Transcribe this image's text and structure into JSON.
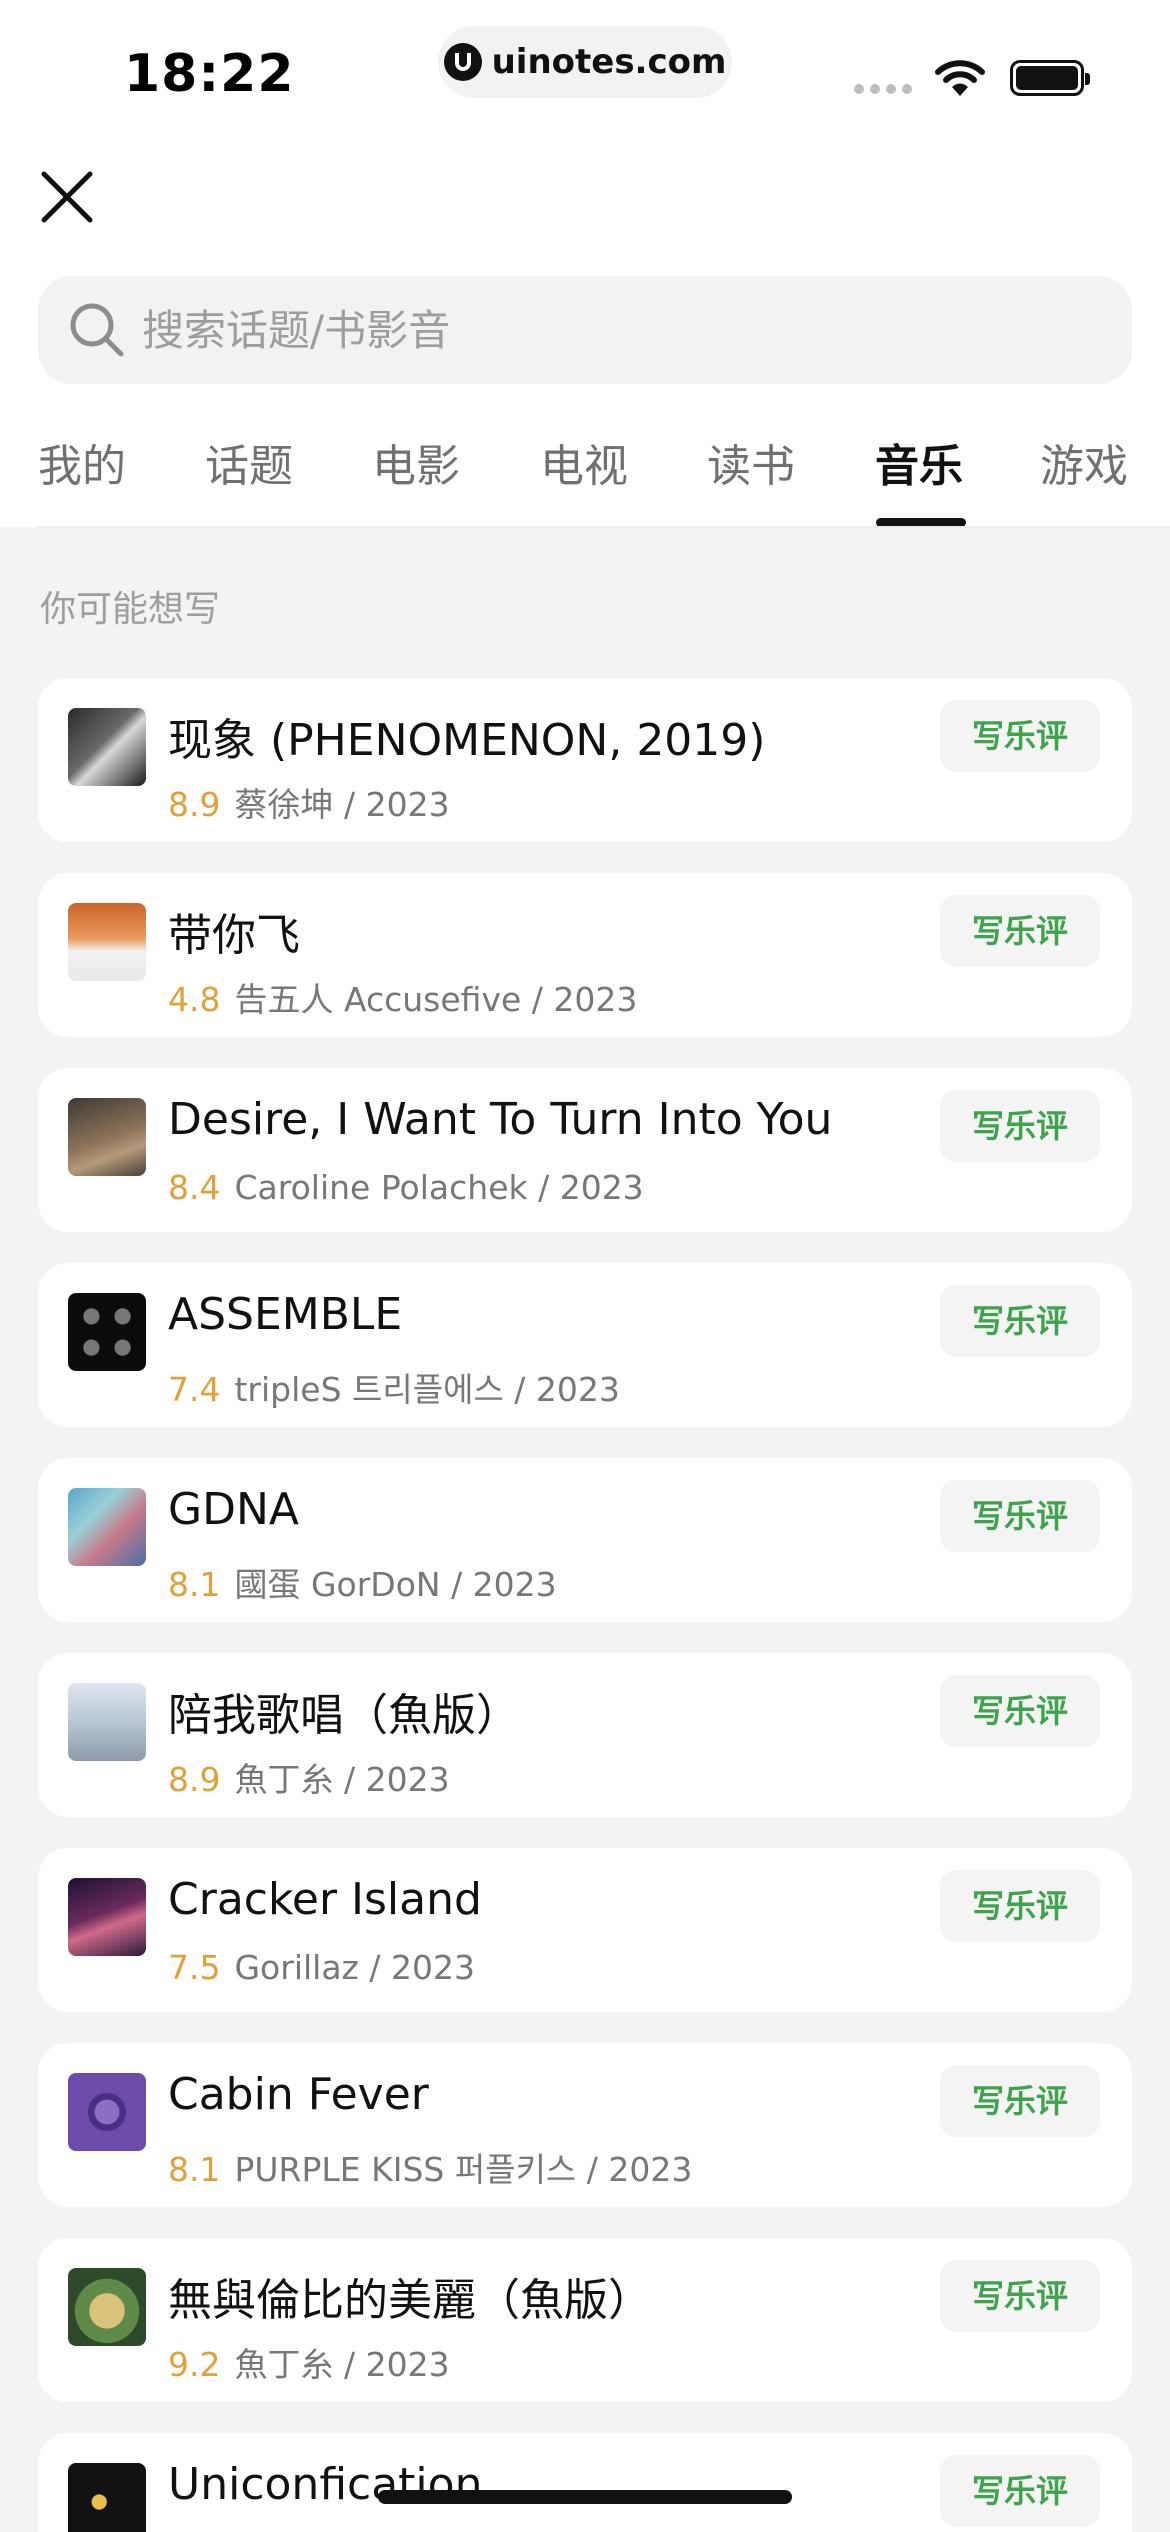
{
  "status": {
    "time": "18:22",
    "url": "uinotes.com"
  },
  "search": {
    "placeholder": "搜索话题/书影音"
  },
  "tabs": [
    "我的",
    "话题",
    "电影",
    "电视",
    "读书",
    "音乐",
    "游戏"
  ],
  "active_tab": "音乐",
  "section_title": "你可能想写",
  "review_label": "写乐评",
  "items": [
    {
      "title": "现象 (PHENOMENON, 2019)",
      "rating": "8.9",
      "subtitle": "蔡徐坤 / 2023"
    },
    {
      "title": "带你飞",
      "rating": "4.8",
      "subtitle": "告五人 Accusefive / 2023"
    },
    {
      "title": "Desire, I Want To Turn Into You",
      "rating": "8.4",
      "subtitle": "Caroline Polachek / 2023"
    },
    {
      "title": "ASSEMBLE",
      "rating": "7.4",
      "subtitle": "tripleS 트리플에스 / 2023"
    },
    {
      "title": "GDNA",
      "rating": "8.1",
      "subtitle": "國蛋 GorDoN / 2023"
    },
    {
      "title": "陪我歌唱（魚版）",
      "rating": "8.9",
      "subtitle": "魚丁糸 / 2023"
    },
    {
      "title": "Cracker Island",
      "rating": "7.5",
      "subtitle": "Gorillaz / 2023"
    },
    {
      "title": "Cabin Fever",
      "rating": "8.1",
      "subtitle": "PURPLE KISS 퍼플키스 / 2023"
    },
    {
      "title": "無與倫比的美麗（魚版）",
      "rating": "9.2",
      "subtitle": "魚丁糸 / 2023"
    },
    {
      "title": "Uniconfication",
      "rating": "",
      "subtitle": ""
    }
  ],
  "colors": {
    "rating": "#e0a13a",
    "review_button_text": "#3fa34d",
    "active_tab": "#111111"
  }
}
